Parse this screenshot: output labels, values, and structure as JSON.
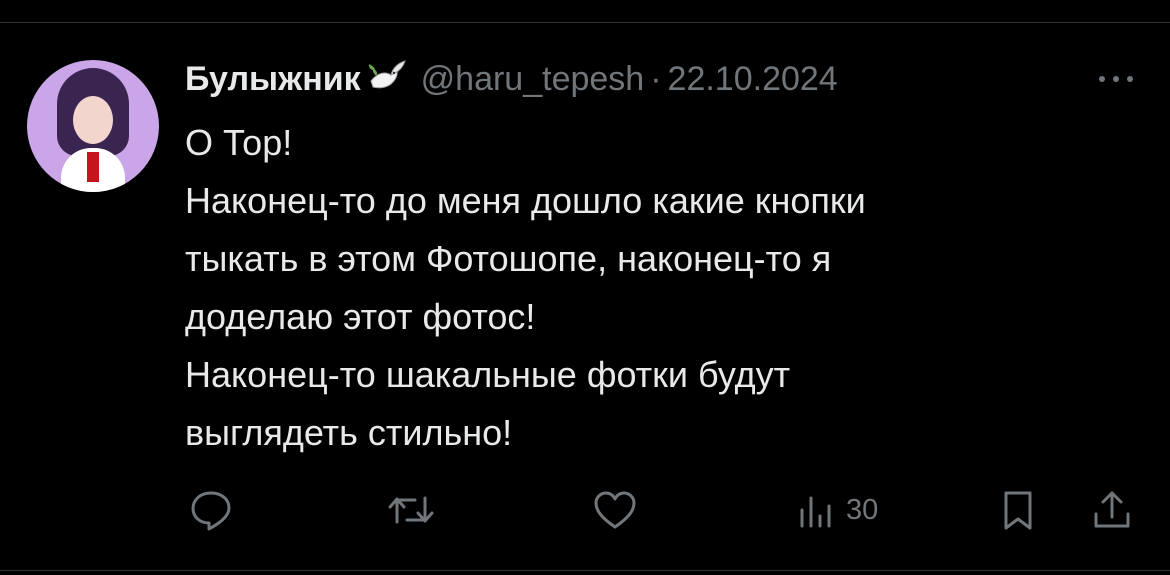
{
  "tweet": {
    "author": {
      "display_name": "Булыжник",
      "badge_icon": "dove-emoji",
      "handle": "@haru_tepesh"
    },
    "separator": "·",
    "date": "22.10.2024",
    "more_icon": "more-dots-icon",
    "text_lines": [
      "О Тор!",
      "Наконец-то до меня дошло какие кнопки",
      "тыкать в этом Фотошопе, наконец-то я",
      "доделаю этот фотос!",
      "Наконец-то шакальные фотки будут",
      "выглядеть стильно!"
    ],
    "actions": {
      "reply_icon": "reply-icon",
      "retweet_icon": "retweet-icon",
      "like_icon": "like-icon",
      "views_icon": "views-icon",
      "views_count": "30",
      "bookmark_icon": "bookmark-icon",
      "share_icon": "share-icon"
    }
  },
  "colors": {
    "background": "#000000",
    "primary_text": "#e7e9ea",
    "secondary_text": "#71767b",
    "divider": "#2f3336"
  }
}
